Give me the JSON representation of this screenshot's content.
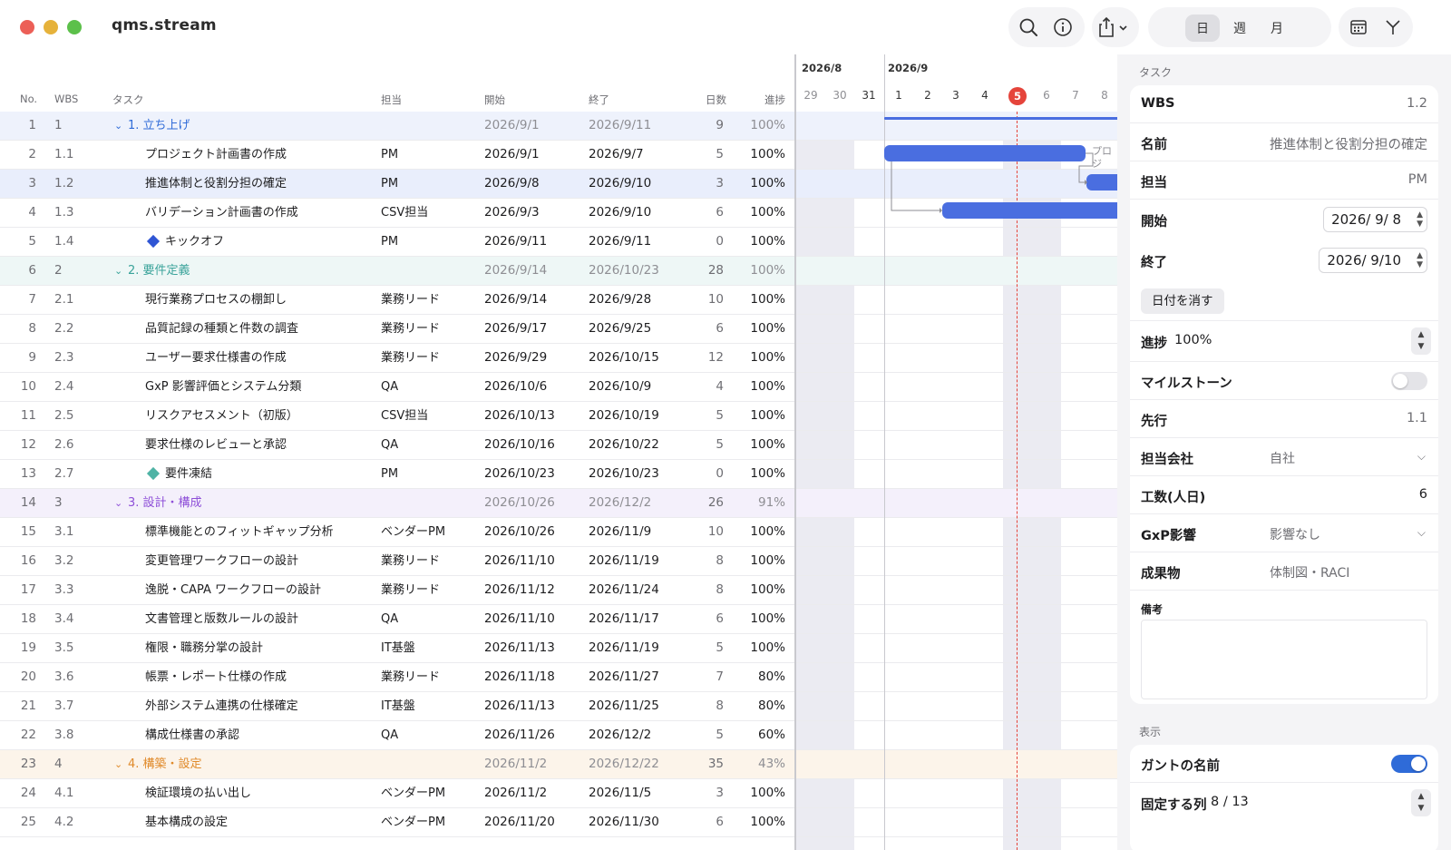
{
  "app": {
    "title": "qms.stream"
  },
  "toolbar": {
    "search_icon": "search-icon",
    "info_icon": "info-icon",
    "share_icon": "share-icon",
    "view_modes": [
      "日",
      "週",
      "月"
    ],
    "active_view": "日",
    "calendar_icon": "calendar-icon",
    "fork_icon": "branch-icon"
  },
  "table": {
    "headers": {
      "no": "No.",
      "wbs": "WBS",
      "task": "タスク",
      "owner": "担当",
      "start": "開始",
      "end": "終了",
      "days": "日数",
      "progress": "進捗"
    },
    "rows": [
      {
        "no": "1",
        "wbs": "1",
        "task": "1. 立ち上げ",
        "owner": "",
        "start": "2026/9/1",
        "end": "2026/9/11",
        "days": "9",
        "progress": "100%",
        "type": "group",
        "color": "#2f6bd8",
        "bg": "#eef2fc"
      },
      {
        "no": "2",
        "wbs": "1.1",
        "task": "プロジェクト計画書の作成",
        "owner": "PM",
        "start": "2026/9/1",
        "end": "2026/9/7",
        "days": "5",
        "progress": "100%",
        "type": "task"
      },
      {
        "no": "3",
        "wbs": "1.2",
        "task": "推進体制と役割分担の確定",
        "owner": "PM",
        "start": "2026/9/8",
        "end": "2026/9/10",
        "days": "3",
        "progress": "100%",
        "type": "task",
        "bg": "#e9eefc"
      },
      {
        "no": "4",
        "wbs": "1.3",
        "task": "バリデーション計画書の作成",
        "owner": "CSV担当",
        "start": "2026/9/3",
        "end": "2026/9/10",
        "days": "6",
        "progress": "100%",
        "type": "task"
      },
      {
        "no": "5",
        "wbs": "1.4",
        "task": "キックオフ",
        "owner": "PM",
        "start": "2026/9/11",
        "end": "2026/9/11",
        "days": "0",
        "progress": "100%",
        "type": "milestone",
        "color": "#2f55d4"
      },
      {
        "no": "6",
        "wbs": "2",
        "task": "2. 要件定義",
        "owner": "",
        "start": "2026/9/14",
        "end": "2026/10/23",
        "days": "28",
        "progress": "100%",
        "type": "group",
        "color": "#3aa39a",
        "bg": "#eef7f6"
      },
      {
        "no": "7",
        "wbs": "2.1",
        "task": "現行業務プロセスの棚卸し",
        "owner": "業務リード",
        "start": "2026/9/14",
        "end": "2026/9/28",
        "days": "10",
        "progress": "100%",
        "type": "task"
      },
      {
        "no": "8",
        "wbs": "2.2",
        "task": "品質記録の種類と件数の調査",
        "owner": "業務リード",
        "start": "2026/9/17",
        "end": "2026/9/25",
        "days": "6",
        "progress": "100%",
        "type": "task"
      },
      {
        "no": "9",
        "wbs": "2.3",
        "task": "ユーザー要求仕様書の作成",
        "owner": "業務リード",
        "start": "2026/9/29",
        "end": "2026/10/15",
        "days": "12",
        "progress": "100%",
        "type": "task"
      },
      {
        "no": "10",
        "wbs": "2.4",
        "task": "GxP 影響評価とシステム分類",
        "owner": "QA",
        "start": "2026/10/6",
        "end": "2026/10/9",
        "days": "4",
        "progress": "100%",
        "type": "task"
      },
      {
        "no": "11",
        "wbs": "2.5",
        "task": "リスクアセスメント（初版）",
        "owner": "CSV担当",
        "start": "2026/10/13",
        "end": "2026/10/19",
        "days": "5",
        "progress": "100%",
        "type": "task"
      },
      {
        "no": "12",
        "wbs": "2.6",
        "task": "要求仕様のレビューと承認",
        "owner": "QA",
        "start": "2026/10/16",
        "end": "2026/10/22",
        "days": "5",
        "progress": "100%",
        "type": "task"
      },
      {
        "no": "13",
        "wbs": "2.7",
        "task": "要件凍結",
        "owner": "PM",
        "start": "2026/10/23",
        "end": "2026/10/23",
        "days": "0",
        "progress": "100%",
        "type": "milestone",
        "color": "#4fb3a5"
      },
      {
        "no": "14",
        "wbs": "3",
        "task": "3. 設計・構成",
        "owner": "",
        "start": "2026/10/26",
        "end": "2026/12/2",
        "days": "26",
        "progress": "91%",
        "type": "group",
        "color": "#8e4fd8",
        "bg": "#f4f0fb"
      },
      {
        "no": "15",
        "wbs": "3.1",
        "task": "標準機能とのフィットギャップ分析",
        "owner": "ベンダーPM",
        "start": "2026/10/26",
        "end": "2026/11/9",
        "days": "10",
        "progress": "100%",
        "type": "task"
      },
      {
        "no": "16",
        "wbs": "3.2",
        "task": "変更管理ワークフローの設計",
        "owner": "業務リード",
        "start": "2026/11/10",
        "end": "2026/11/19",
        "days": "8",
        "progress": "100%",
        "type": "task"
      },
      {
        "no": "17",
        "wbs": "3.3",
        "task": "逸脱・CAPA ワークフローの設計",
        "owner": "業務リード",
        "start": "2026/11/12",
        "end": "2026/11/24",
        "days": "8",
        "progress": "100%",
        "type": "task"
      },
      {
        "no": "18",
        "wbs": "3.4",
        "task": "文書管理と版数ルールの設計",
        "owner": "QA",
        "start": "2026/11/10",
        "end": "2026/11/17",
        "days": "6",
        "progress": "100%",
        "type": "task"
      },
      {
        "no": "19",
        "wbs": "3.5",
        "task": "権限・職務分掌の設計",
        "owner": "IT基盤",
        "start": "2026/11/13",
        "end": "2026/11/19",
        "days": "5",
        "progress": "100%",
        "type": "task"
      },
      {
        "no": "20",
        "wbs": "3.6",
        "task": "帳票・レポート仕様の作成",
        "owner": "業務リード",
        "start": "2026/11/18",
        "end": "2026/11/27",
        "days": "7",
        "progress": "80%",
        "type": "task"
      },
      {
        "no": "21",
        "wbs": "3.7",
        "task": "外部システム連携の仕様確定",
        "owner": "IT基盤",
        "start": "2026/11/13",
        "end": "2026/11/25",
        "days": "8",
        "progress": "80%",
        "type": "task"
      },
      {
        "no": "22",
        "wbs": "3.8",
        "task": "構成仕様書の承認",
        "owner": "QA",
        "start": "2026/11/26",
        "end": "2026/12/2",
        "days": "5",
        "progress": "60%",
        "type": "task"
      },
      {
        "no": "23",
        "wbs": "4",
        "task": "4. 構築・設定",
        "owner": "",
        "start": "2026/11/2",
        "end": "2026/12/22",
        "days": "35",
        "progress": "43%",
        "type": "group",
        "color": "#e08a2a",
        "bg": "#fcf4ea"
      },
      {
        "no": "24",
        "wbs": "4.1",
        "task": "検証環境の払い出し",
        "owner": "ベンダーPM",
        "start": "2026/11/2",
        "end": "2026/11/5",
        "days": "3",
        "progress": "100%",
        "type": "task"
      },
      {
        "no": "25",
        "wbs": "4.2",
        "task": "基本構成の設定",
        "owner": "ベンダーPM",
        "start": "2026/11/20",
        "end": "2026/11/30",
        "days": "6",
        "progress": "100%",
        "type": "task"
      }
    ]
  },
  "gantt": {
    "months": [
      "2026/8",
      "2026/9"
    ],
    "days": [
      "29",
      "30",
      "31",
      "1",
      "2",
      "3",
      "4",
      "5",
      "6",
      "7",
      "8"
    ],
    "today": "5",
    "bar_label": "プロジ",
    "colors": {
      "bar": "#4a6ee0",
      "today_line": "#e5443b",
      "weekend": "#ebebf2"
    }
  },
  "panel": {
    "task_section": "タスク",
    "wbs_label": "WBS",
    "wbs_value": "1.2",
    "name_label": "名前",
    "name_value": "推進体制と役割分担の確定",
    "owner_label": "担当",
    "owner_value": "PM",
    "start_label": "開始",
    "start_value": "2026/ 9/ 8",
    "end_label": "終了",
    "end_value": "2026/ 9/10",
    "clear_date_button": "日付を消す",
    "progress_label": "進捗",
    "progress_value": "100%",
    "milestone_label": "マイルストーン",
    "milestone_on": false,
    "predecessor_label": "先行",
    "predecessor_value": "1.1",
    "company_label": "担当会社",
    "company_value": "自社",
    "effort_label": "工数(人日)",
    "effort_value": "6",
    "gxp_label": "GxP影響",
    "gxp_value": "影響なし",
    "deliverable_label": "成果物",
    "deliverable_value": "体制図・RACI",
    "notes_label": "備考",
    "notes_value": "",
    "display_section": "表示",
    "gantt_names_label": "ガントの名前",
    "gantt_names_on": true,
    "frozen_cols_label": "固定する列",
    "frozen_cols_value": "8 / 13"
  }
}
